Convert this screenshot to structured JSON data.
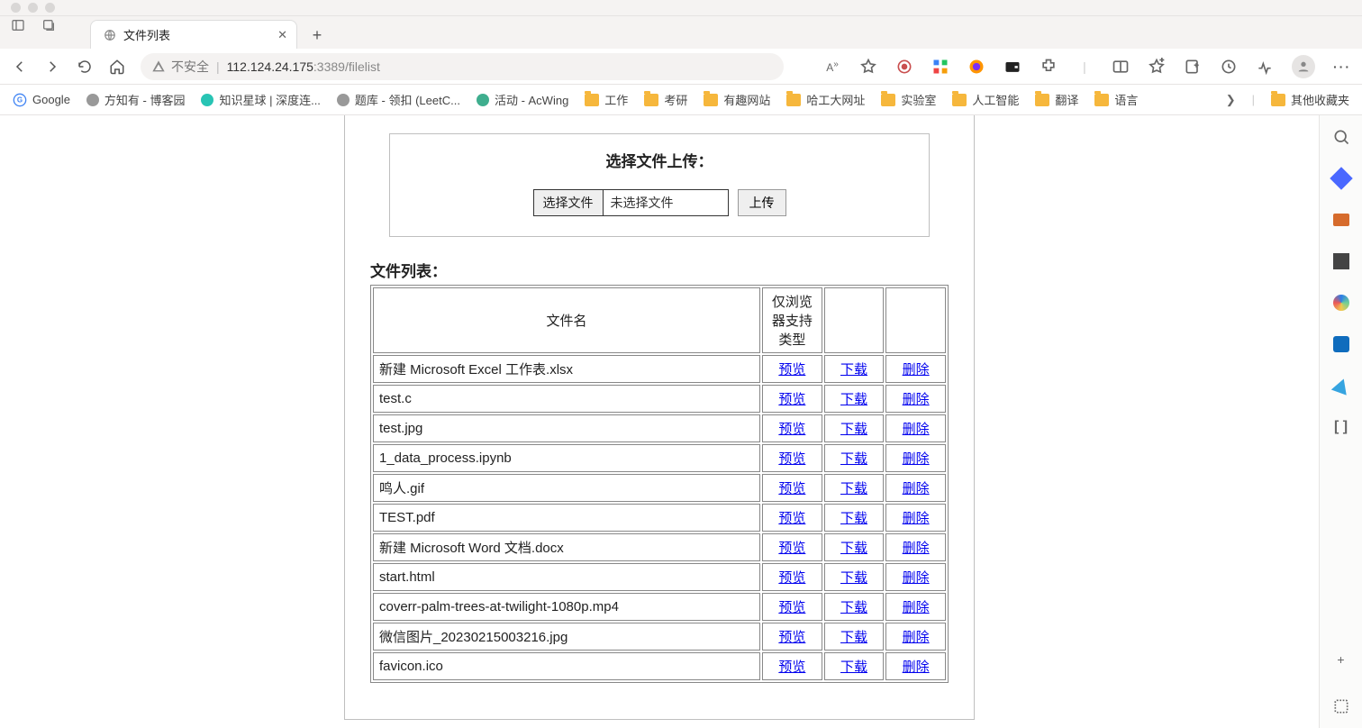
{
  "browser": {
    "tab_title": "文件列表",
    "security_label": "不安全",
    "url_ip": "112.124.24.175",
    "url_port": ":3389",
    "url_path": "/filelist",
    "reader_label": "A"
  },
  "bookmarks": {
    "items": [
      {
        "label": "Google",
        "type": "g"
      },
      {
        "label": "方知有 - 博客园",
        "type": "icon"
      },
      {
        "label": "知识星球 | 深度连...",
        "type": "circ",
        "color": "#28c4b4"
      },
      {
        "label": "题库 - 领扣 (LeetC...",
        "type": "icon"
      },
      {
        "label": "活动 - AcWing",
        "type": "circ",
        "color": "#3fae8e"
      },
      {
        "label": "工作",
        "type": "folder"
      },
      {
        "label": "考研",
        "type": "folder"
      },
      {
        "label": "有趣网站",
        "type": "folder"
      },
      {
        "label": "哈工大网址",
        "type": "folder"
      },
      {
        "label": "实验室",
        "type": "folder"
      },
      {
        "label": "人工智能",
        "type": "folder"
      },
      {
        "label": "翻译",
        "type": "folder"
      },
      {
        "label": "语言",
        "type": "folder"
      }
    ],
    "other_label": "其他收藏夹"
  },
  "upload": {
    "heading": "选择文件上传：",
    "choose_btn": "选择文件",
    "no_file": "未选择文件",
    "submit": "上传"
  },
  "list": {
    "heading": "文件列表：",
    "col_name": "文件名",
    "col_preview_header": "仅浏览器支持类型",
    "preview": "预览",
    "download": "下载",
    "delete": "删除",
    "files": [
      "新建 Microsoft Excel 工作表.xlsx",
      "test.c",
      "test.jpg",
      "1_data_process.ipynb",
      "鸣人.gif",
      "TEST.pdf",
      "新建 Microsoft Word 文档.docx",
      "start.html",
      "coverr-palm-trees-at-twilight-1080p.mp4",
      "微信图片_20230215003216.jpg",
      "favicon.ico"
    ]
  }
}
